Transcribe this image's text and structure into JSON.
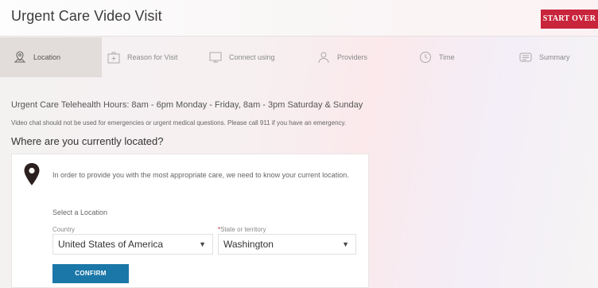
{
  "header": {
    "title": "Urgent Care Video Visit",
    "start_over_label": "START OVER"
  },
  "steps": [
    {
      "label": "Location",
      "icon": "location-pin-icon",
      "active": true
    },
    {
      "label": "Reason for Visit",
      "icon": "medical-bag-icon",
      "active": false
    },
    {
      "label": "Connect using",
      "icon": "monitor-icon",
      "active": false
    },
    {
      "label": "Providers",
      "icon": "user-icon",
      "active": false
    },
    {
      "label": "Time",
      "icon": "clock-icon",
      "active": false
    },
    {
      "label": "Summary",
      "icon": "list-icon",
      "active": false
    }
  ],
  "content": {
    "hours": "Urgent Care Telehealth Hours: 8am - 6pm Monday - Friday, 8am - 3pm Saturday & Sunday",
    "warning": "Video chat should not be used for emergencies or urgent medical questions.  Please call 911 if you have an emergency.",
    "question": "Where are you currently located?"
  },
  "card": {
    "message": "In order to provide you with the most appropriate care, we need to know your current location.",
    "select_location_label": "Select a Location",
    "country_label": "Country",
    "country_value": "United States of America",
    "state_required_marker": "*",
    "state_label": "State or territory",
    "state_value": "Washington",
    "confirm_label": "CONFIRM"
  },
  "colors": {
    "accent_red": "#c8243b",
    "confirm_blue": "#1a77a8"
  }
}
